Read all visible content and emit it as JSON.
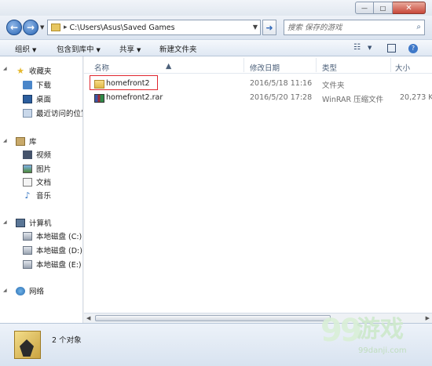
{
  "titlebar": {
    "minimize_glyph": "—",
    "maximize_glyph": "□",
    "close_glyph": "✕"
  },
  "address": {
    "path": "C:\\Users\\Asus\\Saved Games",
    "separator": "▸"
  },
  "search": {
    "placeholder": "搜索 保存的游戏"
  },
  "toolbar": {
    "organize_label": "组织",
    "include_label": "包含到库中",
    "share_label": "共享",
    "new_folder_label": "新建文件夹"
  },
  "navpane": {
    "favorites": "收藏夹",
    "downloads": "下载",
    "desktop": "桌面",
    "recent": "最近访问的位置",
    "libraries": "库",
    "videos": "视频",
    "pictures": "图片",
    "documents": "文档",
    "music": "音乐",
    "computer": "计算机",
    "disk_c": "本地磁盘 (C:)",
    "disk_d": "本地磁盘 (D:)",
    "disk_e": "本地磁盘 (E:)",
    "network": "网络"
  },
  "columns": {
    "name": "名称",
    "modified": "修改日期",
    "type": "类型",
    "size": "大小"
  },
  "files": [
    {
      "name": "homefront2",
      "modified": "2016/5/18 11:16",
      "type": "文件夹",
      "size": ""
    },
    {
      "name": "homefront2.rar",
      "modified": "2016/5/20 17:28",
      "type": "WinRAR 压缩文件",
      "size": "20,273 K"
    }
  ],
  "details": {
    "count": "2 个对象"
  },
  "watermark": {
    "logo": "99",
    "text": "游戏",
    "url": "99danji.com"
  }
}
